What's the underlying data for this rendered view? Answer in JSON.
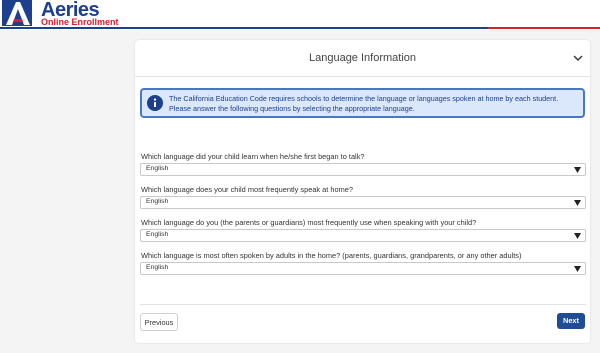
{
  "header": {
    "logo_letter": "A",
    "brand": "Aeries",
    "subbrand": "Online Enrollment",
    "colors": {
      "blue": "#1c3f8e",
      "red": "#d6202a"
    }
  },
  "section": {
    "title": "Language Information",
    "toggle_icon": "chevron-down-icon",
    "info_icon": "info-circle-icon",
    "info_text": "The California Education Code requires schools to determine the language or languages spoken at home by each student. Please answer the following questions by selecting the appropriate language."
  },
  "questions": [
    {
      "label": "Which language did your child learn when he/she first began to talk?",
      "value": "English"
    },
    {
      "label": "Which language does your child most frequently speak at home?",
      "value": "English"
    },
    {
      "label": "Which language do you (the parents or guardians) most frequently use when speaking with your child?",
      "value": "English"
    },
    {
      "label": "Which language is most often spoken by adults in the home? (parents, guardians, grandparents, or any other adults)",
      "value": "English"
    }
  ],
  "buttons": {
    "previous": "Previous",
    "next": "Next",
    "next_color": "#1f4c92"
  }
}
